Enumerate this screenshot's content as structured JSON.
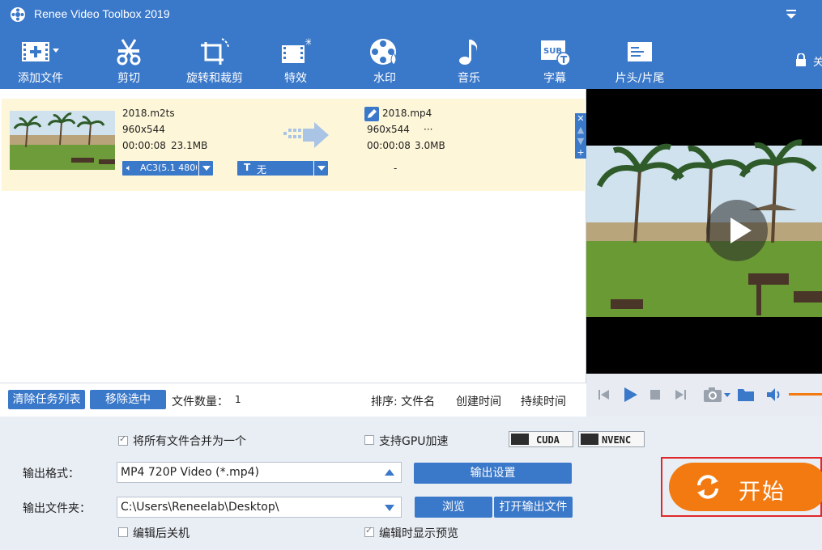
{
  "app": {
    "title": "Renee Video Toolbox 2019"
  },
  "toolbar": {
    "items": [
      {
        "label": "添加文件",
        "icon": "add-file-icon"
      },
      {
        "label": "剪切",
        "icon": "scissors-icon"
      },
      {
        "label": "旋转和裁剪",
        "icon": "rotate-crop-icon"
      },
      {
        "label": "特效",
        "icon": "effects-icon"
      },
      {
        "label": "水印",
        "icon": "watermark-icon"
      },
      {
        "label": "音乐",
        "icon": "music-icon"
      },
      {
        "label": "字幕",
        "icon": "subtitle-icon"
      },
      {
        "label": "片头/片尾",
        "icon": "intro-outro-icon"
      }
    ],
    "lock_label": "关"
  },
  "file": {
    "source_name": "2018.m2ts",
    "source_res": "960x544",
    "source_duration": "00:00:08",
    "source_size": "23.1MB",
    "audio_track": "AC3(5.1 4800",
    "subtitle_track": "无",
    "output_name": "2018.mp4",
    "output_res": "960x544",
    "output_extra": "···",
    "output_duration": "00:00:08",
    "output_size": "3.0MB",
    "output_subtitle": "-"
  },
  "listbar": {
    "clear_label": "清除任务列表",
    "remove_label": "移除选中",
    "count_label": "文件数量：",
    "count_value": "1",
    "sort_label": "排序: 文件名",
    "sort_created": "创建时间",
    "sort_duration": "持续时间"
  },
  "settings": {
    "merge_label": "将所有文件合并为一个",
    "merge_checked": true,
    "gpu_label": "支持GPU加速",
    "gpu_checked": false,
    "cuda_label": "CUDA",
    "nvenc_label": "NVENC",
    "format_label": "输出格式：",
    "format_value": "MP4 720P Video (*.mp4)",
    "output_settings_label": "输出设置",
    "folder_label": "输出文件夹：",
    "folder_value": "C:\\Users\\Reneelab\\Desktop\\",
    "browse_label": "浏览",
    "open_folder_label": "打开输出文件",
    "shutdown_label": "编辑后关机",
    "shutdown_checked": false,
    "preview_label": "编辑时显示预览",
    "preview_checked": true,
    "start_label": "开始"
  },
  "colors": {
    "accent": "#3a78c9",
    "start": "#f37a10",
    "highlight_row": "#fdf6d8",
    "start_border": "#e0282b"
  }
}
